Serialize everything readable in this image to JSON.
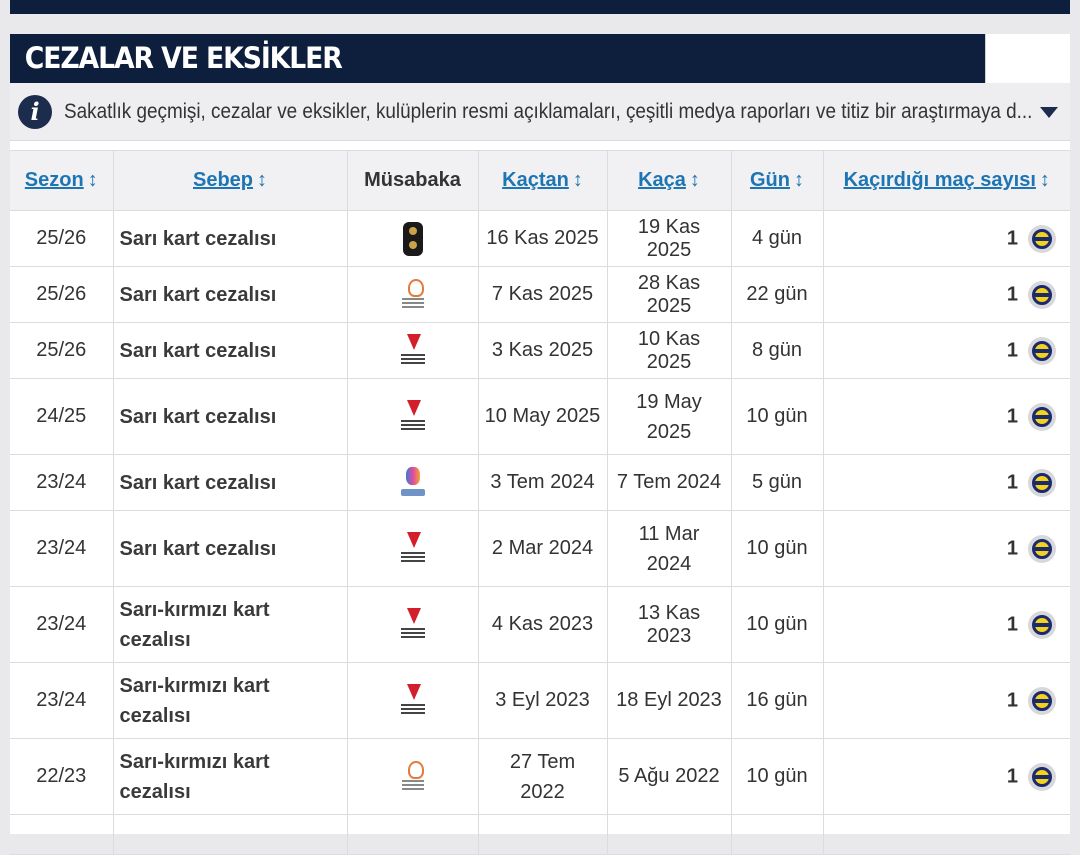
{
  "header": {
    "title": "CEZALAR VE EKSİKLER",
    "info_text": "Sakatlık geçmişi, cezalar ve eksikler, kulüplerin resmi açıklamaları, çeşitli medya raporları ve titiz bir araştırmaya d..."
  },
  "table": {
    "columns": {
      "season": "Sezon",
      "reason": "Sebep",
      "competition": "Müsabaka",
      "from": "Kaçtan",
      "until": "Kaça",
      "days": "Gün",
      "games_missed": "Kaçırdığı maç sayısı"
    },
    "sort_glyph": "↕",
    "rows": [
      {
        "season": "25/26",
        "reason": "Sarı kart cezalısı",
        "competition_icon": "dark-cup-icon",
        "from": "16 Kas 2025",
        "until": "19 Kas 2025",
        "days": "4 gün",
        "games": "1",
        "club_icon": "fenerbahce-crest-icon"
      },
      {
        "season": "25/26",
        "reason": "Sarı kart cezalısı",
        "competition_icon": "europa-league-icon",
        "from": "7 Kas 2025",
        "until": "28 Kas 2025",
        "days": "22 gün",
        "games": "1",
        "club_icon": "fenerbahce-crest-icon"
      },
      {
        "season": "25/26",
        "reason": "Sarı kart cezalısı",
        "competition_icon": "super-lig-icon",
        "from": "3 Kas 2025",
        "until": "10 Kas 2025",
        "days": "8 gün",
        "games": "1",
        "club_icon": "fenerbahce-crest-icon"
      },
      {
        "season": "24/25",
        "reason": "Sarı kart cezalısı",
        "competition_icon": "super-lig-icon",
        "from": "10 May 2025",
        "until": "19 May 2025",
        "days": "10 gün",
        "games": "1",
        "club_icon": "fenerbahce-crest-icon"
      },
      {
        "season": "23/24",
        "reason": "Sarı kart cezalısı",
        "competition_icon": "euro-2024-icon",
        "from": "3 Tem 2024",
        "until": "7 Tem 2024",
        "days": "5 gün",
        "games": "1",
        "club_icon": "fenerbahce-crest-icon"
      },
      {
        "season": "23/24",
        "reason": "Sarı kart cezalısı",
        "competition_icon": "super-lig-icon",
        "from": "2 Mar 2024",
        "until": "11 Mar 2024",
        "days": "10 gün",
        "games": "1",
        "club_icon": "fenerbahce-crest-icon"
      },
      {
        "season": "23/24",
        "reason": "Sarı-kırmızı kart cezalısı",
        "competition_icon": "super-lig-icon",
        "from": "4 Kas 2023",
        "until": "13 Kas 2023",
        "days": "10 gün",
        "games": "1",
        "club_icon": "fenerbahce-crest-icon"
      },
      {
        "season": "23/24",
        "reason": "Sarı-kırmızı kart cezalısı",
        "competition_icon": "super-lig-icon",
        "from": "3 Eyl 2023",
        "until": "18 Eyl 2023",
        "days": "16 gün",
        "games": "1",
        "club_icon": "fenerbahce-crest-icon"
      },
      {
        "season": "22/23",
        "reason": "Sarı-kırmızı kart cezalısı",
        "competition_icon": "europa-league-icon",
        "from": "27 Tem 2022",
        "until": "5 Ağu 2022",
        "days": "10 gün",
        "games": "1",
        "club_icon": "fenerbahce-crest-icon"
      }
    ]
  }
}
